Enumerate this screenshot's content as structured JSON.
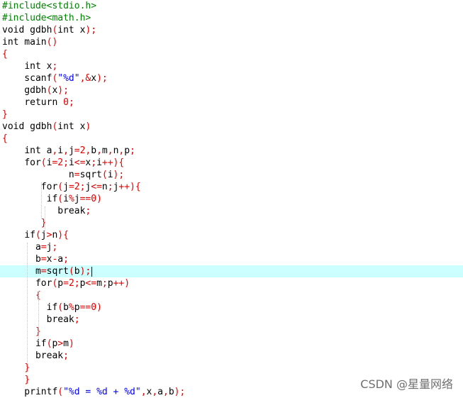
{
  "editor": {
    "current_line": 22,
    "lines": [
      [
        [
          "pre",
          "#include<stdio.h>"
        ]
      ],
      [
        [
          "pre",
          "#include<math.h>"
        ]
      ],
      [
        [
          "kw",
          "void"
        ],
        [
          "id",
          " gdbh"
        ],
        [
          "op",
          "("
        ],
        [
          "kw",
          "int"
        ],
        [
          "id",
          " x"
        ],
        [
          "op",
          ");"
        ]
      ],
      [
        [
          "kw",
          "int"
        ],
        [
          "id",
          " main"
        ],
        [
          "op",
          "()"
        ]
      ],
      [
        [
          "op",
          "{"
        ]
      ],
      [
        [
          "id",
          "    "
        ],
        [
          "kw",
          "int"
        ],
        [
          "id",
          " x"
        ],
        [
          "op",
          ";"
        ]
      ],
      [
        [
          "id",
          "    scanf"
        ],
        [
          "op",
          "("
        ],
        [
          "str",
          "\"%d\""
        ],
        [
          "op",
          ",&"
        ],
        [
          "id",
          "x"
        ],
        [
          "op",
          ");"
        ]
      ],
      [
        [
          "id",
          "    gdbh"
        ],
        [
          "op",
          "("
        ],
        [
          "id",
          "x"
        ],
        [
          "op",
          ");"
        ]
      ],
      [
        [
          "id",
          "    "
        ],
        [
          "kw",
          "return"
        ],
        [
          "id",
          " "
        ],
        [
          "num",
          "0"
        ],
        [
          "op",
          ";"
        ]
      ],
      [
        [
          "op",
          "}"
        ]
      ],
      [
        [
          "kw",
          "void"
        ],
        [
          "id",
          " gdbh"
        ],
        [
          "op",
          "("
        ],
        [
          "kw",
          "int"
        ],
        [
          "id",
          " x"
        ],
        [
          "op",
          ")"
        ]
      ],
      [
        [
          "op",
          "{"
        ]
      ],
      [
        [
          "id",
          "    "
        ],
        [
          "kw",
          "int"
        ],
        [
          "id",
          " a"
        ],
        [
          "op",
          ","
        ],
        [
          "id",
          "i"
        ],
        [
          "op",
          ","
        ],
        [
          "id",
          "j"
        ],
        [
          "op",
          "="
        ],
        [
          "num",
          "2"
        ],
        [
          "op",
          ","
        ],
        [
          "id",
          "b"
        ],
        [
          "op",
          ","
        ],
        [
          "id",
          "m"
        ],
        [
          "op",
          ","
        ],
        [
          "id",
          "n"
        ],
        [
          "op",
          ","
        ],
        [
          "id",
          "p"
        ],
        [
          "op",
          ";"
        ]
      ],
      [
        [
          "id",
          "    "
        ],
        [
          "kw",
          "for"
        ],
        [
          "op",
          "("
        ],
        [
          "id",
          "i"
        ],
        [
          "op",
          "="
        ],
        [
          "num",
          "2"
        ],
        [
          "op",
          ";"
        ],
        [
          "id",
          "i"
        ],
        [
          "op",
          "<="
        ],
        [
          "id",
          "x"
        ],
        [
          "op",
          ";"
        ],
        [
          "id",
          "i"
        ],
        [
          "op",
          "++){"
        ]
      ],
      [
        [
          "id",
          "            n"
        ],
        [
          "op",
          "="
        ],
        [
          "id",
          "sqrt"
        ],
        [
          "op",
          "("
        ],
        [
          "id",
          "i"
        ],
        [
          "op",
          ");"
        ]
      ],
      [
        [
          "id",
          "       "
        ],
        [
          "kw",
          "for"
        ],
        [
          "op",
          "("
        ],
        [
          "id",
          "j"
        ],
        [
          "op",
          "="
        ],
        [
          "num",
          "2"
        ],
        [
          "op",
          ";"
        ],
        [
          "id",
          "j"
        ],
        [
          "op",
          "<="
        ],
        [
          "id",
          "n"
        ],
        [
          "op",
          ";"
        ],
        [
          "id",
          "j"
        ],
        [
          "op",
          "++){"
        ]
      ],
      [
        [
          "id",
          "        "
        ],
        [
          "kw",
          "if"
        ],
        [
          "op",
          "("
        ],
        [
          "id",
          "i"
        ],
        [
          "op",
          "%"
        ],
        [
          "id",
          "j"
        ],
        [
          "op",
          "=="
        ],
        [
          "num",
          "0"
        ],
        [
          "op",
          ")"
        ]
      ],
      [
        [
          "id",
          "          "
        ],
        [
          "kw",
          "break"
        ],
        [
          "op",
          ";"
        ]
      ],
      [
        [
          "id",
          "       "
        ],
        [
          "op",
          "}"
        ]
      ],
      [
        [
          "id",
          "    "
        ],
        [
          "kw",
          "if"
        ],
        [
          "op",
          "("
        ],
        [
          "id",
          "j"
        ],
        [
          "op",
          ">"
        ],
        [
          "id",
          "n"
        ],
        [
          "op",
          "){"
        ]
      ],
      [
        [
          "id",
          "      a"
        ],
        [
          "op",
          "="
        ],
        [
          "id",
          "j"
        ],
        [
          "op",
          ";"
        ]
      ],
      [
        [
          "id",
          "      b"
        ],
        [
          "op",
          "="
        ],
        [
          "id",
          "x"
        ],
        [
          "op",
          "-"
        ],
        [
          "id",
          "a"
        ],
        [
          "op",
          ";"
        ]
      ],
      [
        [
          "id",
          "      m"
        ],
        [
          "op",
          "="
        ],
        [
          "id",
          "sqrt"
        ],
        [
          "op",
          "("
        ],
        [
          "id",
          "b"
        ],
        [
          "op",
          ");"
        ]
      ],
      [
        [
          "id",
          "      "
        ],
        [
          "kw",
          "for"
        ],
        [
          "op",
          "("
        ],
        [
          "id",
          "p"
        ],
        [
          "op",
          "="
        ],
        [
          "num",
          "2"
        ],
        [
          "op",
          ";"
        ],
        [
          "id",
          "p"
        ],
        [
          "op",
          "<="
        ],
        [
          "id",
          "m"
        ],
        [
          "op",
          ";"
        ],
        [
          "id",
          "p"
        ],
        [
          "op",
          "++)"
        ]
      ],
      [
        [
          "id",
          "      "
        ],
        [
          "op",
          "{"
        ]
      ],
      [
        [
          "id",
          "        "
        ],
        [
          "kw",
          "if"
        ],
        [
          "op",
          "("
        ],
        [
          "id",
          "b"
        ],
        [
          "op",
          "%"
        ],
        [
          "id",
          "p"
        ],
        [
          "op",
          "=="
        ],
        [
          "num",
          "0"
        ],
        [
          "op",
          ")"
        ]
      ],
      [
        [
          "id",
          "        "
        ],
        [
          "kw",
          "break"
        ],
        [
          "op",
          ";"
        ]
      ],
      [
        [
          "id",
          "      "
        ],
        [
          "op",
          "}"
        ]
      ],
      [
        [
          "id",
          "      "
        ],
        [
          "kw",
          "if"
        ],
        [
          "op",
          "("
        ],
        [
          "id",
          "p"
        ],
        [
          "op",
          ">"
        ],
        [
          "id",
          "m"
        ],
        [
          "op",
          ")"
        ]
      ],
      [
        [
          "id",
          "      "
        ],
        [
          "kw",
          "break"
        ],
        [
          "op",
          ";"
        ]
      ],
      [
        [
          "id",
          "    "
        ],
        [
          "op",
          "}"
        ]
      ],
      [
        [
          "id",
          "    "
        ],
        [
          "op",
          "}"
        ]
      ],
      [
        [
          "id",
          "    printf"
        ],
        [
          "op",
          "("
        ],
        [
          "str",
          "\"%d = %d + %d\""
        ],
        [
          "op",
          ","
        ],
        [
          "id",
          "x"
        ],
        [
          "op",
          ","
        ],
        [
          "id",
          "a"
        ],
        [
          "op",
          ","
        ],
        [
          "id",
          "b"
        ],
        [
          "op",
          ");"
        ]
      ]
    ]
  },
  "watermark": "CSDN @星量网络"
}
